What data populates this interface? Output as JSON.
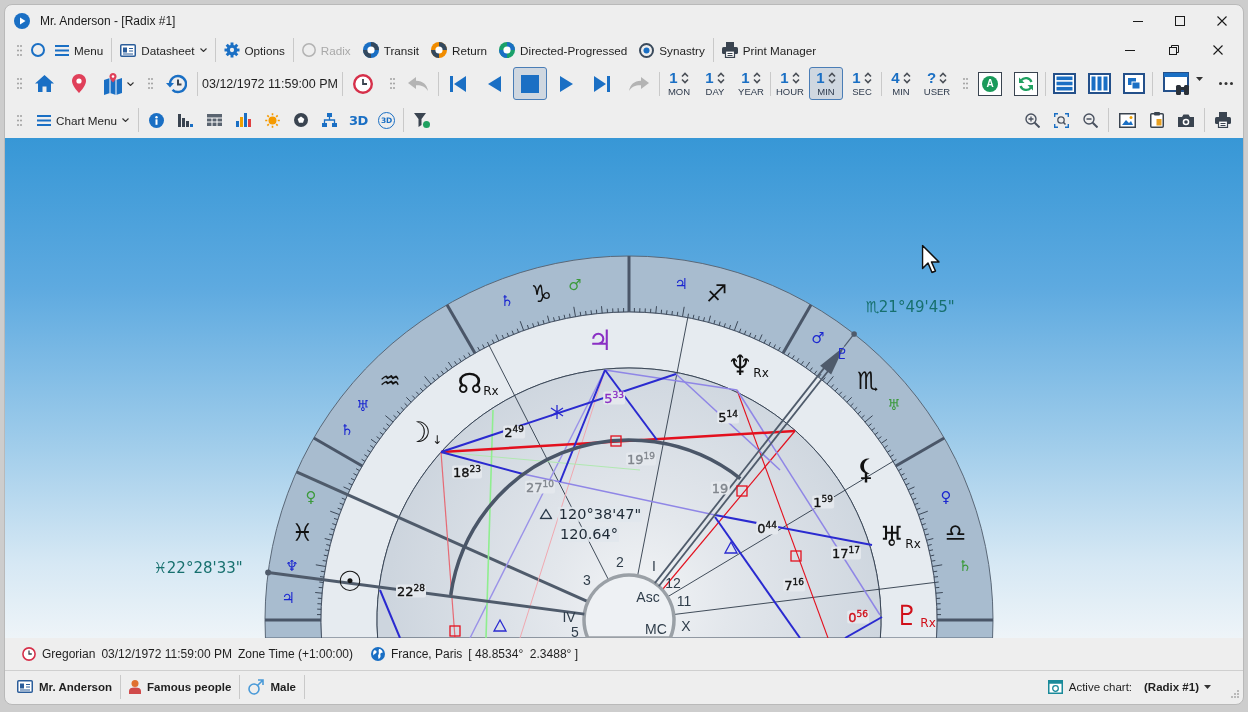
{
  "window": {
    "title": "Mr. Anderson - [Radix #1]"
  },
  "menu_bar": {
    "items": [
      {
        "label": "Menu",
        "disabled": false
      },
      {
        "label": "Datasheet",
        "disabled": false
      },
      {
        "label": "Options",
        "disabled": false
      },
      {
        "label": "Radix",
        "disabled": true
      },
      {
        "label": "Transit",
        "disabled": false
      },
      {
        "label": "Return",
        "disabled": false
      },
      {
        "label": "Directed-Progressed",
        "disabled": false
      },
      {
        "label": "Synastry",
        "disabled": false
      },
      {
        "label": "Print Manager",
        "disabled": false
      }
    ]
  },
  "toolbar": {
    "date_time": "03/12/1972 11:59:00 PM",
    "undo": {
      "disabled": true
    },
    "playback": [
      {
        "selected": false
      },
      {
        "selected": false
      },
      {
        "selected": true
      },
      {
        "selected": false
      },
      {
        "selected": false
      }
    ],
    "redo": {
      "disabled": true
    },
    "step_groups": [
      [
        {
          "value": "1",
          "unit": "MON",
          "selected": false
        },
        {
          "value": "1",
          "unit": "DAY",
          "selected": false
        },
        {
          "value": "1",
          "unit": "YEAR",
          "selected": false
        }
      ],
      [
        {
          "value": "1",
          "unit": "HOUR",
          "selected": false
        },
        {
          "value": "1",
          "unit": "MIN",
          "selected": true
        },
        {
          "value": "1",
          "unit": "SEC",
          "selected": false
        }
      ],
      [
        {
          "value": "4",
          "unit": "MIN",
          "selected": false
        },
        {
          "value": "?",
          "unit": "USER",
          "selected": false
        }
      ]
    ],
    "letter_button": "A"
  },
  "chart_toolbar": {
    "menu_label": "Chart Menu",
    "text_tools": [
      {
        "label": "3D",
        "kind": "plain"
      },
      {
        "label": "3D",
        "kind": "circled"
      }
    ]
  },
  "chart": {
    "signs": [
      "♓",
      "♒",
      "♑",
      "♐",
      "♏",
      "♎"
    ],
    "band_markers": [
      {
        "glyph": "♂",
        "color": "#3c9a3c"
      },
      {
        "glyph": "♃",
        "color": "#1c28d0"
      },
      {
        "glyph": "♄",
        "color": "#1c28d0"
      },
      {
        "glyph": "♂",
        "color": "#1c28d0"
      },
      {
        "glyph": "♇",
        "color": "#1c28d0"
      },
      {
        "glyph": "♅",
        "color": "#1c28d0"
      },
      {
        "glyph": "♅",
        "color": "#3c9a3c"
      },
      {
        "glyph": "♄",
        "color": "#1c28d0"
      },
      {
        "glyph": "♀",
        "color": "#3c9a3c"
      },
      {
        "glyph": "♀",
        "color": "#1c28d0"
      },
      {
        "glyph": "♆",
        "color": "#1c28d0"
      },
      {
        "glyph": "♄",
        "color": "#3c9a3c"
      },
      {
        "glyph": "♃",
        "color": "#1c28d0"
      }
    ],
    "planets": [
      {
        "glyph": "♃",
        "color": "#8a2fc4"
      },
      {
        "glyph": "♆",
        "mark": "Rx",
        "color": "#111111"
      },
      {
        "glyph": "☊",
        "mark": "Rx",
        "color": "#111111"
      },
      {
        "glyph": "☽",
        "mark": "↓",
        "color": "#111111"
      },
      {
        "glyph": "⚸",
        "color": "#111111"
      },
      {
        "glyph": "♅",
        "mark": "Rx",
        "color": "#111111"
      },
      {
        "glyph": "☉",
        "color": "#111111"
      },
      {
        "glyph": "♇",
        "mark": "Rx",
        "color": "#d0101a"
      }
    ],
    "degree_labels": [
      {
        "text": "5$^{33}$",
        "color": "#8a2fc4"
      },
      {
        "text": "5$^{14}$",
        "color": "#111111"
      },
      {
        "text": "2$^{49}$",
        "color": "#111111"
      },
      {
        "text": "19$^{19}$",
        "color": "#80868d"
      },
      {
        "text": "18$^{23}$",
        "color": "#111111"
      },
      {
        "text": "19",
        "color": "#80868d"
      },
      {
        "text": "27$^{10}$",
        "color": "#80868d"
      },
      {
        "text": "1$^{59}$",
        "color": "#111111"
      },
      {
        "text": "0$^{44}$",
        "color": "#111111"
      },
      {
        "text": "17$^{17}$",
        "color": "#111111"
      },
      {
        "text": "7$^{16}$",
        "color": "#111111"
      },
      {
        "text": "22$^{28}$",
        "color": "#111111"
      },
      {
        "text": "0$^{56}$",
        "color": "#d0101a"
      }
    ],
    "aspect_readout": {
      "angle": "120°38'47\"",
      "decimal": "120.64°"
    },
    "cursor_readouts": [
      "♏21°49'45\"",
      "♓22°28'33\""
    ],
    "house_labels": [
      "2",
      "I",
      "3",
      "12",
      "Asc",
      "11",
      "IV",
      "5",
      "MC",
      "X"
    ]
  },
  "status_bar": {
    "calendar": "Gregorian",
    "date_time": "03/12/1972 11:59:00 PM",
    "time_zone": "Zone Time (+1:00:00)",
    "place": "France, Paris",
    "coordinates": "[ 48.8534°  2.3488° ]"
  },
  "info_bar": {
    "person": "Mr. Anderson",
    "group": "Famous people",
    "gender": "Male",
    "active_chart_label": "Active chart:",
    "active_chart": "(Radix #1)"
  }
}
